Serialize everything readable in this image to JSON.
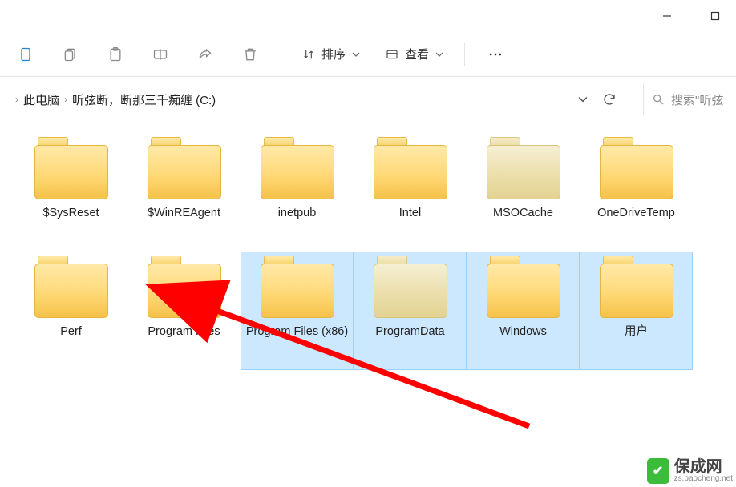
{
  "toolbar": {
    "sort_label": "排序",
    "view_label": "查看"
  },
  "breadcrumb": {
    "items": [
      "此电脑",
      "听弦断，断那三千痴缠 (C:)"
    ]
  },
  "search": {
    "placeholder": "搜索\"听弦"
  },
  "folders": [
    {
      "name": "$SysReset",
      "selected": false,
      "pale": false
    },
    {
      "name": "$WinREAgent",
      "selected": false,
      "pale": false
    },
    {
      "name": "inetpub",
      "selected": false,
      "pale": false
    },
    {
      "name": "Intel",
      "selected": false,
      "pale": false
    },
    {
      "name": "MSOCache",
      "selected": false,
      "pale": true
    },
    {
      "name": "OneDriveTemp",
      "selected": false,
      "pale": false
    },
    {
      "name": "Perf",
      "selected": false,
      "pale": false
    },
    {
      "name": "Program Files",
      "selected": false,
      "pale": false
    },
    {
      "name": "Program Files (x86)",
      "selected": true,
      "pale": false
    },
    {
      "name": "ProgramData",
      "selected": true,
      "pale": true
    },
    {
      "name": "Windows",
      "selected": true,
      "pale": false
    },
    {
      "name": "用户",
      "selected": true,
      "pale": false
    }
  ],
  "watermark": {
    "brand": "保成网",
    "url": "zs.baocheng.net"
  }
}
